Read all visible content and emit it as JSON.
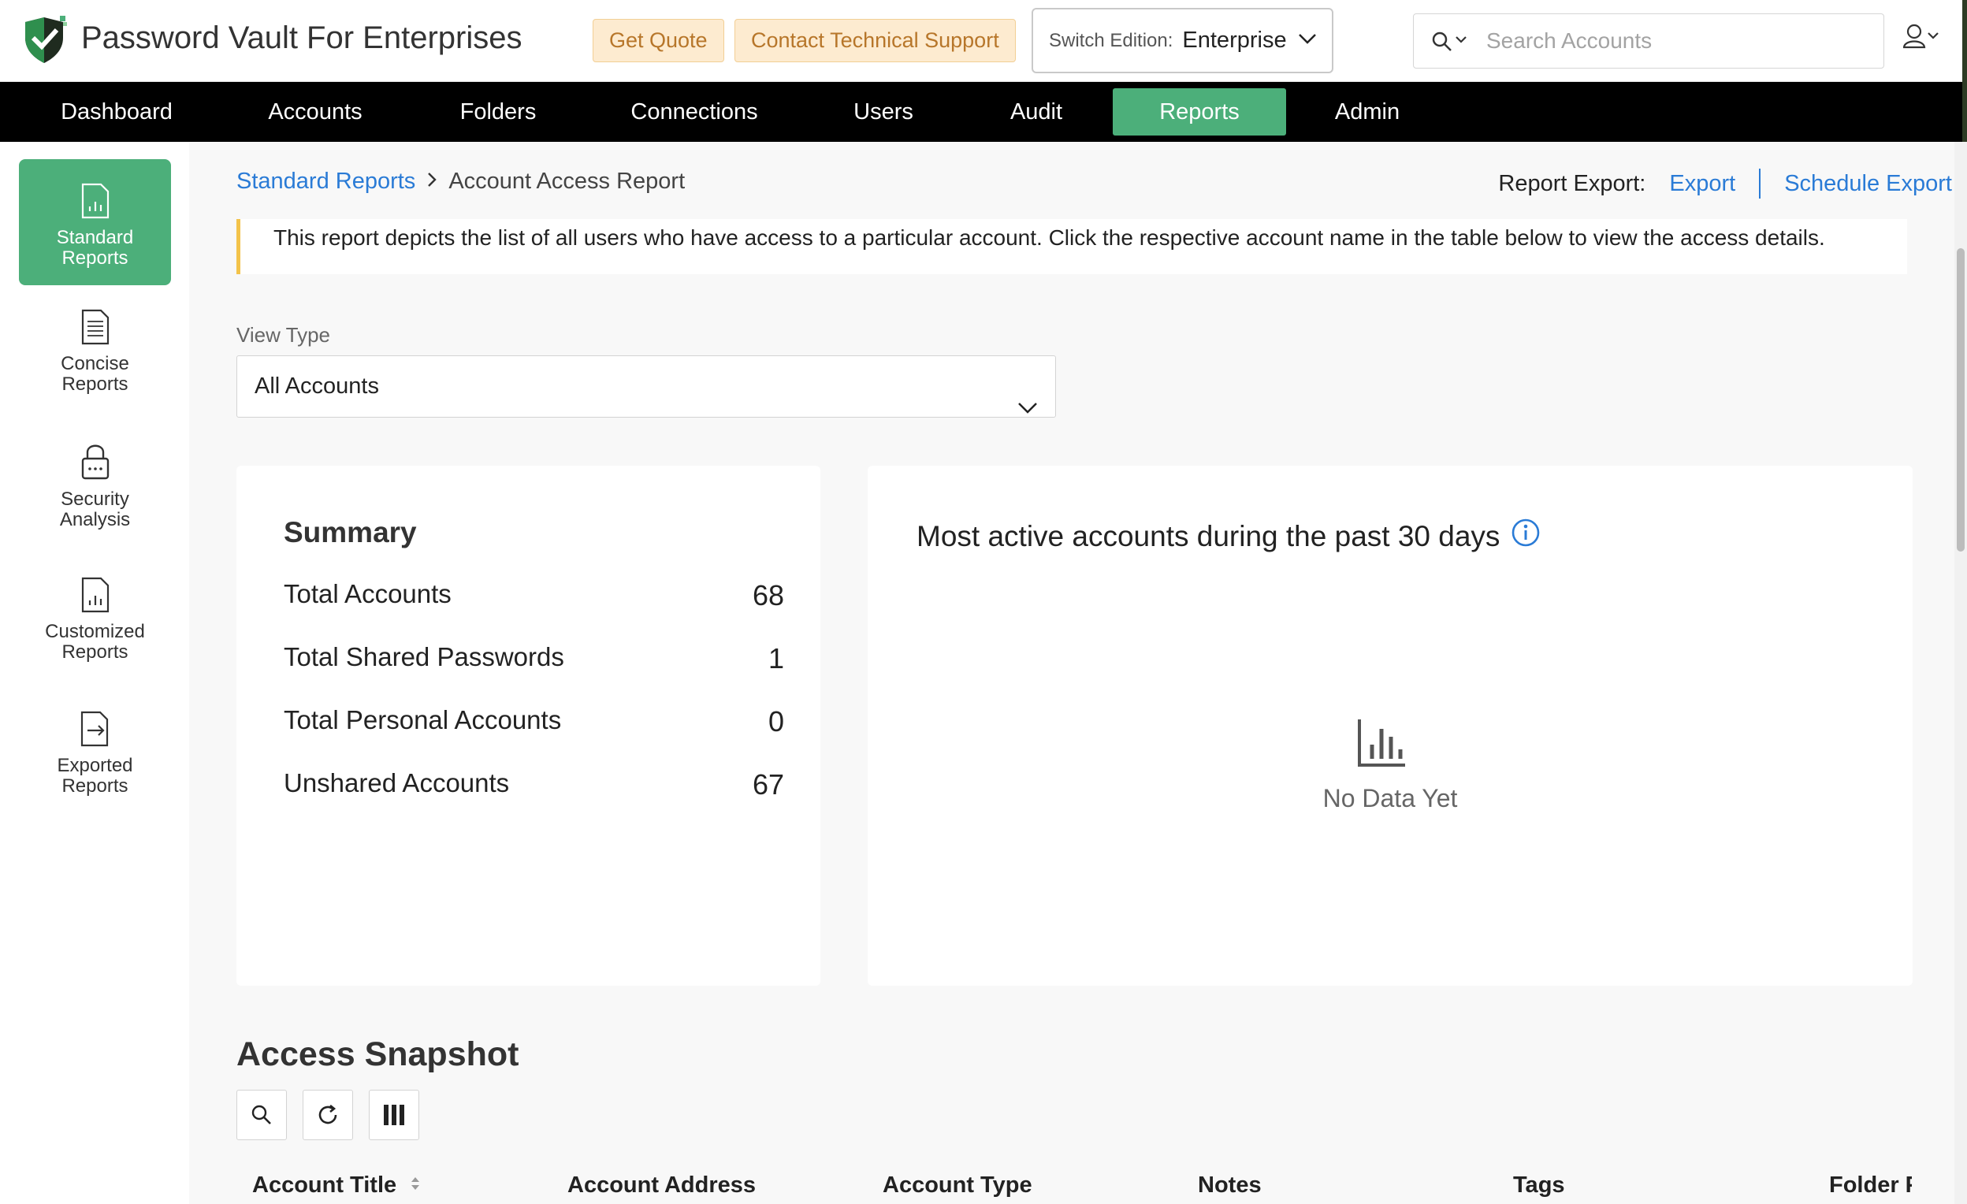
{
  "header": {
    "app_title": "Password Vault For Enterprises",
    "get_quote": "Get Quote",
    "contact_support": "Contact Technical Support",
    "edition_label": "Switch Edition:",
    "edition_value": "Enterprise",
    "search_placeholder": "Search Accounts",
    "icons": {
      "logo": "shield-logo-icon",
      "search": "search-icon",
      "user": "user-icon"
    }
  },
  "nav": {
    "items": [
      "Dashboard",
      "Accounts",
      "Folders",
      "Connections",
      "Users",
      "Audit",
      "Reports",
      "Admin"
    ],
    "active": "Reports"
  },
  "sidebar": {
    "items": [
      {
        "line1": "Standard",
        "line2": "Reports",
        "icon": "report-icon",
        "active": true
      },
      {
        "line1": "Concise",
        "line2": "Reports",
        "icon": "document-icon"
      },
      {
        "line1": "Security",
        "line2": "Analysis",
        "icon": "lock-icon"
      },
      {
        "line1": "Customized",
        "line2": "Reports",
        "icon": "report-icon"
      },
      {
        "line1": "Exported",
        "line2": "Reports",
        "icon": "export-file-icon"
      }
    ]
  },
  "breadcrumb": {
    "parent": "Standard Reports",
    "current": "Account Access Report"
  },
  "report_export": {
    "label": "Report Export:",
    "export": "Export",
    "schedule": "Schedule Export"
  },
  "notice": "This report depicts the list of all users who have access to a particular account. Click the respective account name in the table below to view the access details.",
  "view_type": {
    "label": "View Type",
    "value": "All Accounts"
  },
  "summary": {
    "title": "Summary",
    "rows": [
      {
        "label": "Total Accounts",
        "value": "68"
      },
      {
        "label": "Total Shared Passwords",
        "value": "1"
      },
      {
        "label": "Total Personal Accounts",
        "value": "0"
      },
      {
        "label": "Unshared Accounts",
        "value": "67"
      }
    ]
  },
  "active_accounts": {
    "title": "Most active accounts during the past 30 days",
    "empty": "No Data Yet"
  },
  "snapshot": {
    "title": "Access Snapshot",
    "tools": [
      "search-icon",
      "refresh-icon",
      "columns-icon"
    ],
    "columns": [
      "Account Title",
      "Account Address",
      "Account Type",
      "Notes",
      "Tags",
      "Folder P"
    ]
  },
  "colors": {
    "accent": "#4caf7a",
    "link": "#2a7bd6",
    "nav_bg": "#000000",
    "notice_border": "#f3c34a"
  }
}
